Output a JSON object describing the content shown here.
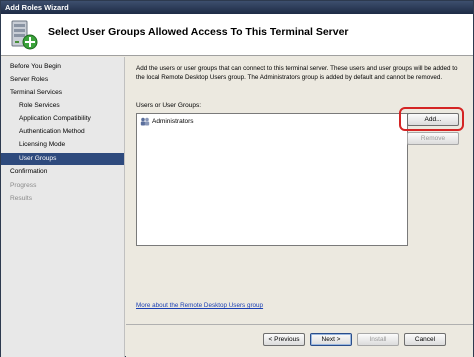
{
  "window": {
    "title": "Add Roles Wizard"
  },
  "header": {
    "title": "Select User Groups Allowed Access To This Terminal Server"
  },
  "nav": {
    "items": [
      {
        "label": "Before You Begin",
        "level": "top",
        "state": "normal"
      },
      {
        "label": "Server Roles",
        "level": "top",
        "state": "normal"
      },
      {
        "label": "Terminal Services",
        "level": "top",
        "state": "normal"
      },
      {
        "label": "Role Services",
        "level": "sub",
        "state": "normal"
      },
      {
        "label": "Application Compatibility",
        "level": "sub",
        "state": "normal"
      },
      {
        "label": "Authentication Method",
        "level": "sub",
        "state": "normal"
      },
      {
        "label": "Licensing Mode",
        "level": "sub",
        "state": "normal"
      },
      {
        "label": "User Groups",
        "level": "sub",
        "state": "selected"
      },
      {
        "label": "Confirmation",
        "level": "top",
        "state": "normal"
      },
      {
        "label": "Progress",
        "level": "top",
        "state": "disabled"
      },
      {
        "label": "Results",
        "level": "top",
        "state": "disabled"
      }
    ]
  },
  "main": {
    "description": "Add the users or user groups that can connect to this terminal server. These users and user groups will be added to the local Remote Desktop Users group. The Administrators group is added by default and cannot be removed.",
    "list_label": "Users or User Groups:",
    "list_items": [
      "Administrators"
    ],
    "add_button": "Add...",
    "remove_button": "Remove",
    "link_text": "More about the Remote Desktop Users group"
  },
  "footer": {
    "previous_button": "< Previous",
    "next_button": "Next >",
    "install_button": "Install",
    "cancel_button": "Cancel"
  },
  "colors": {
    "selected_nav": "#2e4a7d",
    "highlight": "#d42424",
    "link": "#1a3fb3"
  }
}
